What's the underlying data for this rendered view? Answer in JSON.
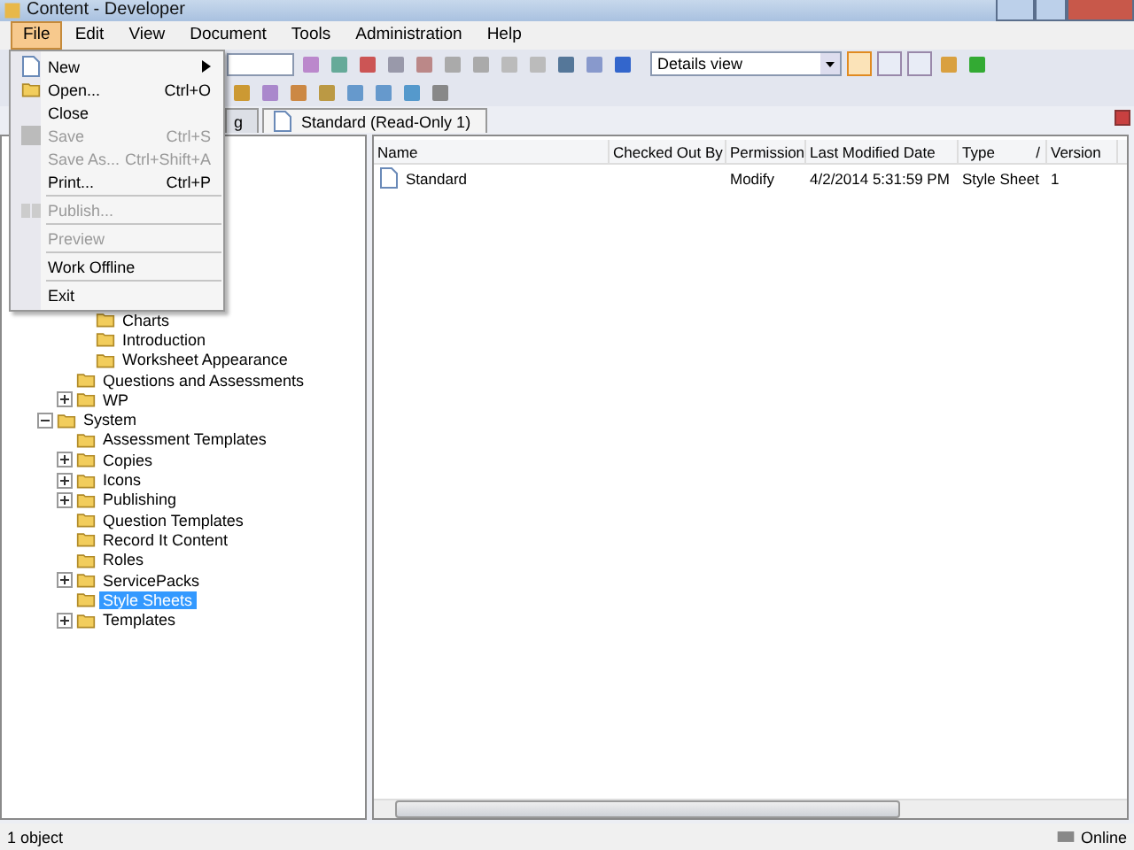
{
  "window": {
    "title": "Content - Developer"
  },
  "menubar": [
    {
      "label": "File",
      "selected": true
    },
    {
      "label": "Edit",
      "selected": false
    },
    {
      "label": "View",
      "selected": false
    },
    {
      "label": "Document",
      "selected": false
    },
    {
      "label": "Tools",
      "selected": false
    },
    {
      "label": "Administration",
      "selected": false
    },
    {
      "label": "Help",
      "selected": false
    }
  ],
  "file_menu": [
    {
      "kind": "item",
      "label": "New",
      "submenu": true,
      "disabled": false
    },
    {
      "kind": "item",
      "label": "Open...",
      "shortcut": "Ctrl+O",
      "disabled": false
    },
    {
      "kind": "item",
      "label": "Close",
      "disabled": false
    },
    {
      "kind": "item",
      "label": "Save",
      "shortcut": "Ctrl+S",
      "disabled": true
    },
    {
      "kind": "item",
      "label": "Save As...",
      "shortcut": "Ctrl+Shift+A",
      "disabled": true
    },
    {
      "kind": "item",
      "label": "Print...",
      "shortcut": "Ctrl+P",
      "disabled": false
    },
    {
      "kind": "separator"
    },
    {
      "kind": "item",
      "label": "Publish...",
      "disabled": true
    },
    {
      "kind": "separator"
    },
    {
      "kind": "item",
      "label": "Preview",
      "disabled": true
    },
    {
      "kind": "separator"
    },
    {
      "kind": "item",
      "label": "Work Offline",
      "disabled": false
    },
    {
      "kind": "separator"
    },
    {
      "kind": "item",
      "label": "Exit",
      "disabled": false
    }
  ],
  "toolbar": {
    "view_select": {
      "value": "Details view"
    },
    "layouts": [
      {
        "selected": true
      },
      {
        "selected": false
      },
      {
        "selected": false
      }
    ]
  },
  "tabs": [
    {
      "label": "g",
      "selected": false
    },
    {
      "label": "Standard (Read-Only 1)",
      "selected": true
    }
  ],
  "tree": [
    {
      "children": [
        {
          "children": [
            {
              "label": "Charts",
              "selected": false
            },
            {
              "label": "Introduction",
              "selected": false
            },
            {
              "label": "Worksheet Appearance",
              "selected": false
            }
          ]
        },
        {
          "label": "Questions and Assessments",
          "selected": false
        },
        {
          "label": "WP",
          "selected": false,
          "expanded": false
        }
      ]
    },
    {
      "label": "System",
      "selected": false,
      "expanded": true,
      "children": [
        {
          "label": "Assessment Templates",
          "selected": false
        },
        {
          "label": "Copies",
          "selected": false,
          "expanded": false
        },
        {
          "label": "Icons",
          "selected": false,
          "expanded": false
        },
        {
          "label": "Publishing",
          "selected": false,
          "expanded": false
        },
        {
          "label": "Question Templates",
          "selected": false
        },
        {
          "label": "Record It Content",
          "selected": false
        },
        {
          "label": "Roles",
          "selected": false
        },
        {
          "label": "ServicePacks",
          "selected": false,
          "expanded": false
        },
        {
          "label": "Style Sheets",
          "selected": true
        },
        {
          "label": "Templates",
          "selected": false,
          "expanded": false
        }
      ]
    }
  ],
  "table": {
    "columns": [
      {
        "label": "Name"
      },
      {
        "label": "Checked Out By"
      },
      {
        "label": "Permission"
      },
      {
        "label": "Last Modified Date"
      },
      {
        "label": "Type",
        "sort_mark": "/"
      },
      {
        "label": "Version"
      }
    ],
    "rows": [
      {
        "name": "Standard",
        "checked_out_by": "",
        "permission": "Modify",
        "last_modified": "4/2/2014 5:31:59 PM",
        "type": "Style Sheet",
        "version": "1"
      }
    ]
  },
  "status_bar": {
    "count": "1 object",
    "connection": "Online"
  }
}
